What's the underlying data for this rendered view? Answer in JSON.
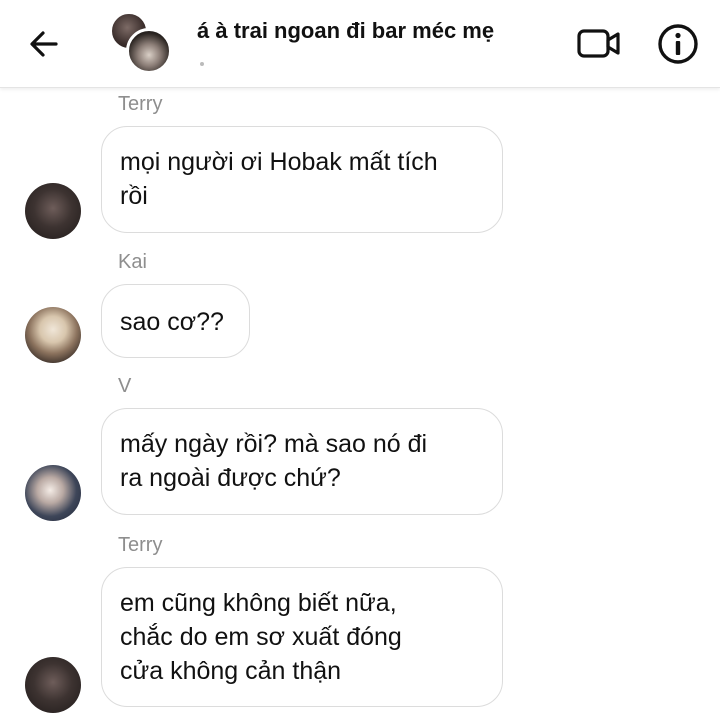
{
  "header": {
    "title": "á à trai ngoan đi bar méc mẹ",
    "back_icon": "arrow-left-icon",
    "video_icon": "video-camera-icon",
    "info_icon": "info-icon"
  },
  "messages": [
    {
      "sender": "Terry",
      "text": "mọi người ơi Hobak mất tích\nrồi"
    },
    {
      "sender": "Kai",
      "text": "sao cơ??"
    },
    {
      "sender": "V",
      "text": "mấy ngày rồi? mà sao nó đi\nra ngoài được chứ?"
    },
    {
      "sender": "Terry",
      "text": "em cũng không biết nữa,\nchắc do em sơ xuất đóng\ncửa không cản thận"
    }
  ]
}
